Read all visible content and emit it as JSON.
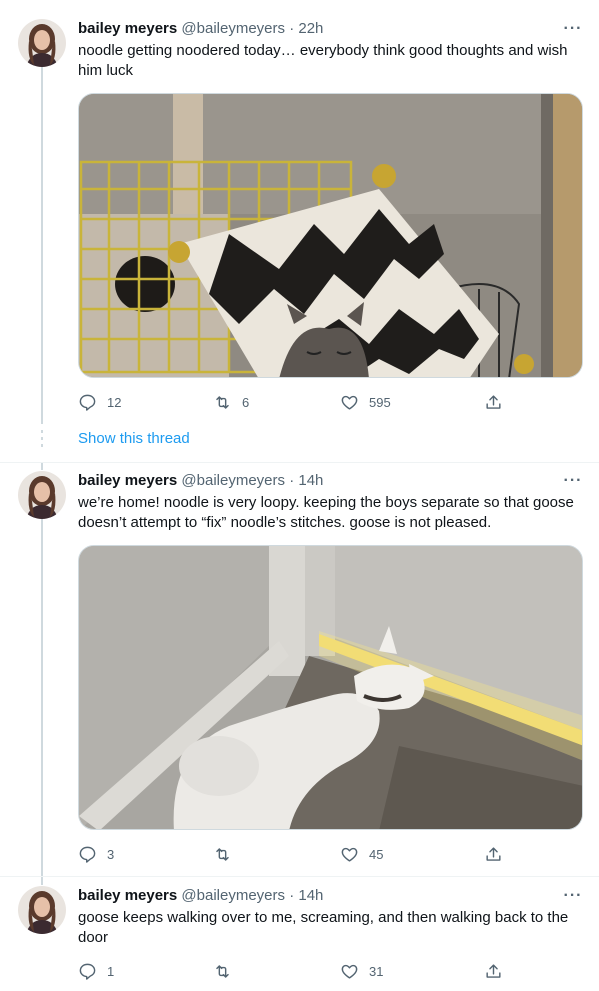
{
  "tweets": [
    {
      "name": "bailey meyers",
      "handle": "@baileymeyers",
      "dot": "·",
      "time": "22h",
      "text": "noodle getting noodered today… everybody think good thoughts and wish him luck",
      "media_description": "",
      "replies": "12",
      "retweets": "6",
      "likes": "595"
    },
    {
      "name": "bailey meyers",
      "handle": "@baileymeyers",
      "dot": "·",
      "time": "14h",
      "text": "we’re home! noodle is very loopy. keeping the boys separate so that goose doesn’t attempt to “fix” noodle’s stitches. goose is not pleased.",
      "replies": "3",
      "retweets": "",
      "likes": "45"
    },
    {
      "name": "bailey meyers",
      "handle": "@baileymeyers",
      "dot": "·",
      "time": "14h",
      "text": "goose keeps walking over to me, screaming, and then walking back to the door",
      "replies": "1",
      "retweets": "",
      "likes": "31"
    }
  ],
  "show_thread": "Show this thread",
  "more_icon": "···",
  "colors": {
    "link": "#1d9bf0",
    "secondary": "#536471",
    "line": "#cfd9de"
  }
}
